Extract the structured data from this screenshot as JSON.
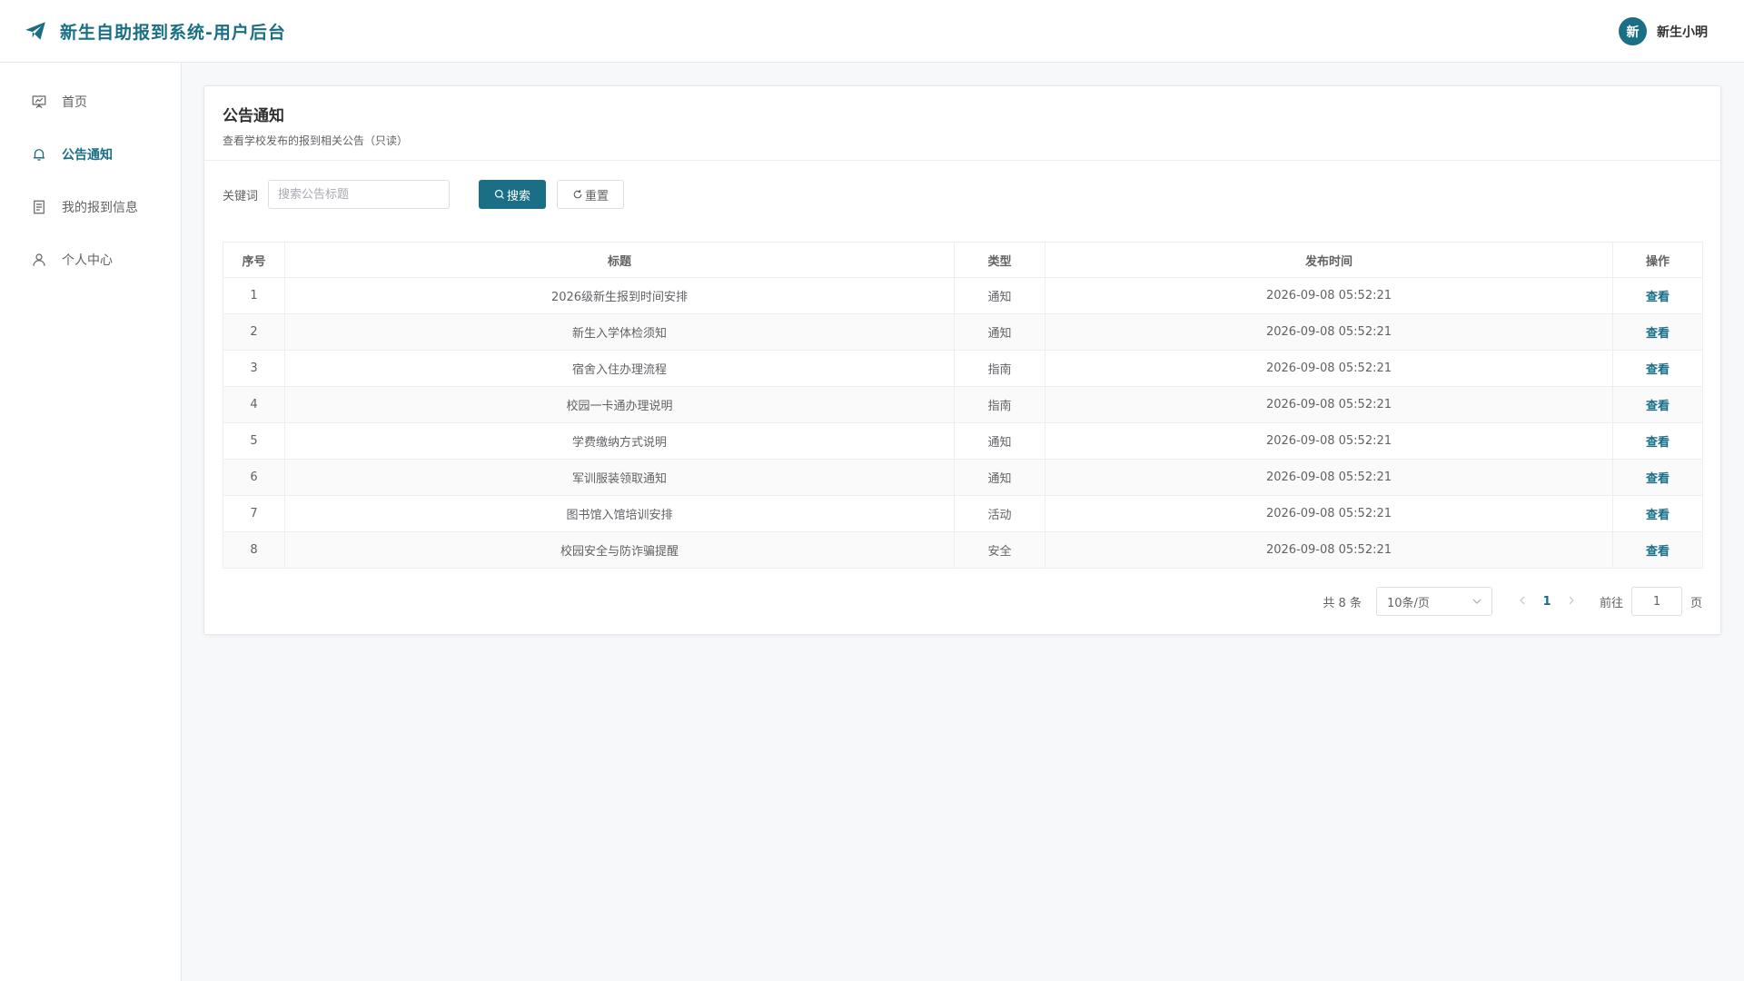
{
  "header": {
    "title": "新生自助报到系统-用户后台",
    "avatar_text": "新",
    "user_name": "新生小明"
  },
  "sidebar": {
    "items": [
      {
        "label": "首页",
        "icon": "presentation-icon"
      },
      {
        "label": "公告通知",
        "icon": "bell-icon",
        "active": true
      },
      {
        "label": "我的报到信息",
        "icon": "document-icon"
      },
      {
        "label": "个人中心",
        "icon": "user-icon"
      }
    ]
  },
  "card": {
    "title": "公告通知",
    "subtitle": "查看学校发布的报到相关公告（只读）"
  },
  "search": {
    "label": "关键词",
    "placeholder": "搜索公告标题",
    "search_btn": "搜索",
    "reset_btn": "重置"
  },
  "table": {
    "headers": [
      "序号",
      "标题",
      "类型",
      "发布时间",
      "操作"
    ],
    "rows": [
      {
        "no": "1",
        "title": "2026级新生报到时间安排",
        "type": "通知",
        "time": "2026-09-08 05:52:21",
        "action": "查看"
      },
      {
        "no": "2",
        "title": "新生入学体检须知",
        "type": "通知",
        "time": "2026-09-08 05:52:21",
        "action": "查看"
      },
      {
        "no": "3",
        "title": "宿舍入住办理流程",
        "type": "指南",
        "time": "2026-09-08 05:52:21",
        "action": "查看"
      },
      {
        "no": "4",
        "title": "校园一卡通办理说明",
        "type": "指南",
        "time": "2026-09-08 05:52:21",
        "action": "查看"
      },
      {
        "no": "5",
        "title": "学费缴纳方式说明",
        "type": "通知",
        "time": "2026-09-08 05:52:21",
        "action": "查看"
      },
      {
        "no": "6",
        "title": "军训服装领取通知",
        "type": "通知",
        "time": "2026-09-08 05:52:21",
        "action": "查看"
      },
      {
        "no": "7",
        "title": "图书馆入馆培训安排",
        "type": "活动",
        "time": "2026-09-08 05:52:21",
        "action": "查看"
      },
      {
        "no": "8",
        "title": "校园安全与防诈骗提醒",
        "type": "安全",
        "time": "2026-09-08 05:52:21",
        "action": "查看"
      }
    ]
  },
  "pager": {
    "total": "共 8 条",
    "page_size": "10条/页",
    "current": "1",
    "goto_label": "前往",
    "goto_value": "1",
    "page_suffix": "页"
  },
  "colors": {
    "accent": "#1a6e85"
  }
}
